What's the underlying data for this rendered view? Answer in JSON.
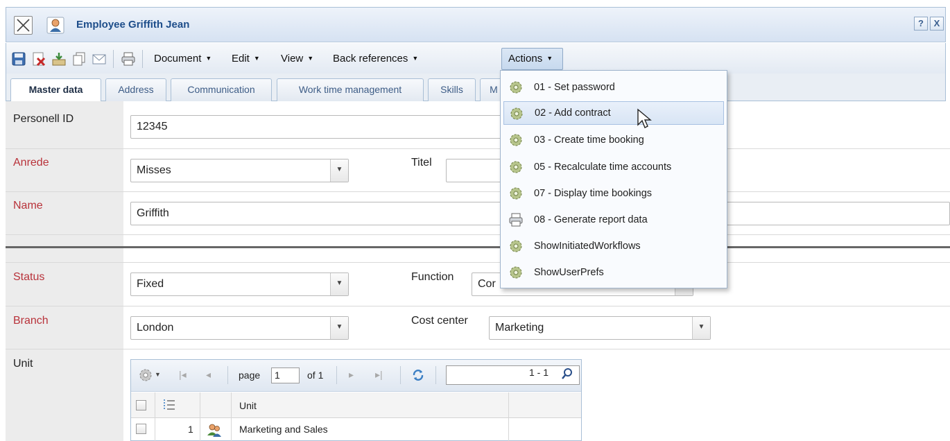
{
  "window": {
    "title": "Employee Griffith Jean",
    "help_label": "?",
    "close_label": "X"
  },
  "toolbar": {
    "menus": {
      "document": "Document",
      "edit": "Edit",
      "view": "View",
      "back_references": "Back references",
      "actions": "Actions"
    },
    "arrow": "▼"
  },
  "tabs": {
    "master_data": "Master data",
    "address": "Address",
    "communication": "Communication",
    "work_time_management": "Work time management",
    "skills": "Skills",
    "partial": "M"
  },
  "form": {
    "personell_id_label": "Personell ID",
    "personell_id_value": "12345",
    "anrede_label": "Anrede",
    "anrede_value": "Misses",
    "titel_label": "Titel",
    "name_label": "Name",
    "name_value": "Griffith",
    "status_label": "Status",
    "status_value": "Fixed",
    "function_label": "Function",
    "function_value": "Cor",
    "branch_label": "Branch",
    "branch_value": "London",
    "cost_center_label": "Cost center",
    "cost_center_value": "Marketing",
    "unit_label": "Unit"
  },
  "grid": {
    "page_label": "page",
    "page_value": "1",
    "of_label": "of 1",
    "range_label": "1 - 1",
    "col_unit": "Unit",
    "rows": [
      {
        "num": "1",
        "unit": "Marketing and Sales"
      }
    ]
  },
  "actions_menu": {
    "items": [
      {
        "label": "01 - Set password",
        "icon": "gear-icon"
      },
      {
        "label": "02 - Add contract",
        "icon": "gear-icon"
      },
      {
        "label": "03 - Create time booking",
        "icon": "gear-icon"
      },
      {
        "label": "05 - Recalculate time accounts",
        "icon": "gear-icon"
      },
      {
        "label": "07 - Display time bookings",
        "icon": "gear-icon"
      },
      {
        "label": "08 - Generate report data",
        "icon": "printer-icon"
      },
      {
        "label": "ShowInitiatedWorkflows",
        "icon": "gear-icon"
      },
      {
        "label": "ShowUserPrefs",
        "icon": "gear-icon"
      }
    ],
    "hovered_index": 1
  },
  "colors": {
    "title_text": "#1d4d8a",
    "required_label": "#b8323a",
    "accent_border": "#a9bfd6"
  }
}
